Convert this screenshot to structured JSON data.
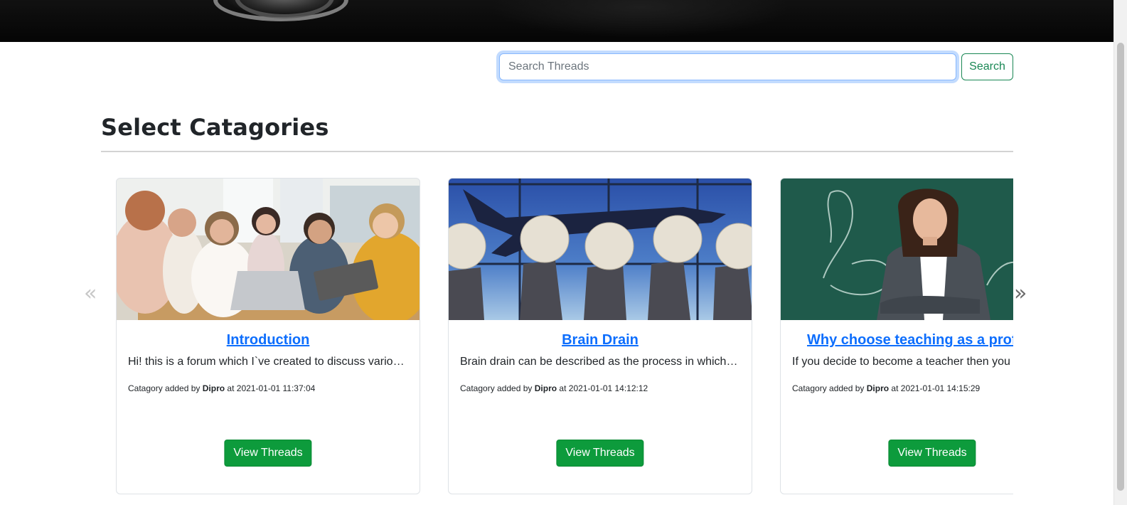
{
  "search": {
    "placeholder": "Search Threads",
    "button_label": "Search"
  },
  "page_title": "Select Catagories",
  "carousel": {
    "prev_symbol": "«",
    "next_symbol": "»",
    "cards": [
      {
        "title": "Introduction",
        "description": "Hi! this is a forum which I`ve created to discuss various...",
        "meta_prefix": "Catagory added by ",
        "author": "Dipro",
        "meta_mid": " at ",
        "timestamp": "2021-01-01 11:37:04",
        "button_label": "View Threads",
        "image": "group-of-students-with-laptop"
      },
      {
        "title": "Brain Drain",
        "description": "Brain drain can be described as the process in which a ...",
        "meta_prefix": "Catagory added by ",
        "author": "Dipro",
        "meta_mid": " at ",
        "timestamp": "2021-01-01 14:12:12",
        "button_label": "View Threads",
        "image": "brain-headed-people-and-airplane"
      },
      {
        "title": "Why choose teaching as a profe",
        "description": "If you decide to become a teacher then you v",
        "meta_prefix": "Catagory added by ",
        "author": "Dipro",
        "meta_mid": " at ",
        "timestamp": "2021-01-01 14:15:29",
        "button_label": "View Threads",
        "image": "teacher-at-chalkboard"
      }
    ]
  },
  "colors": {
    "link": "#0d6efd",
    "success": "#198754",
    "view_button": "#0d9b3c"
  }
}
